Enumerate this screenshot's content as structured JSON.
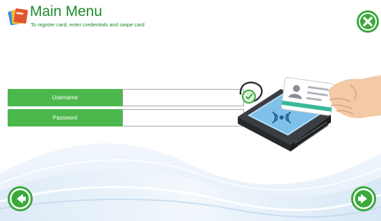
{
  "header": {
    "title": "Main Menu",
    "subtitle": "To register card, enter credentials and swipe card"
  },
  "form": {
    "username_label": "Username",
    "username_value": "",
    "password_label": "Password",
    "password_value": ""
  },
  "icons": {
    "app": "app-logo-icon",
    "close": "close-icon",
    "back": "arrow-left-icon",
    "next": "arrow-right-icon",
    "illustration": "card-reader-swipe-illustration"
  },
  "colors": {
    "accent_green": "#4cb84c",
    "title_green": "#1b8a2a",
    "button_green": "#3aa93a"
  }
}
